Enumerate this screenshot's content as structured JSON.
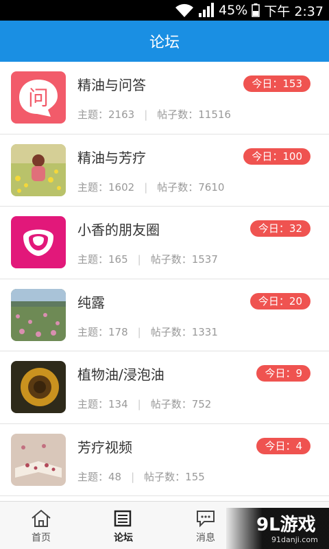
{
  "status_bar": {
    "battery": "45%",
    "time": "下午 2:37"
  },
  "header": {
    "title": "论坛"
  },
  "forums": [
    {
      "title": "精油与问答",
      "today": "今日：153",
      "topics": "主题：2163",
      "posts": "帖子数：11516",
      "thumb": "ask-icon"
    },
    {
      "title": "精油与芳疗",
      "today": "今日：100",
      "topics": "主题：1602",
      "posts": "帖子数：7610",
      "thumb": "flower-field-photo"
    },
    {
      "title": "小香的朋友圈",
      "today": "今日：32",
      "topics": "主题：165",
      "posts": "帖子数：1537",
      "thumb": "rose-icon"
    },
    {
      "title": "纯露",
      "today": "今日：20",
      "topics": "主题：178",
      "posts": "帖子数：1331",
      "thumb": "rose-field-photo"
    },
    {
      "title": "植物油/浸泡油",
      "today": "今日：9",
      "topics": "主题：134",
      "posts": "帖子数：752",
      "thumb": "sunflower-photo"
    },
    {
      "title": "芳疗视频",
      "today": "今日：4",
      "topics": "主题：48",
      "posts": "帖子数：155",
      "thumb": "book-petals-photo"
    }
  ],
  "tabs": [
    {
      "label": "首页",
      "icon": "home-icon"
    },
    {
      "label": "论坛",
      "icon": "forum-icon",
      "active": true
    },
    {
      "label": "消息",
      "icon": "message-icon"
    }
  ],
  "watermark": {
    "logo": "9L游戏",
    "url": "91danji.com"
  },
  "colors": {
    "primary": "#1a8fe3",
    "badge": "#ef5350"
  }
}
